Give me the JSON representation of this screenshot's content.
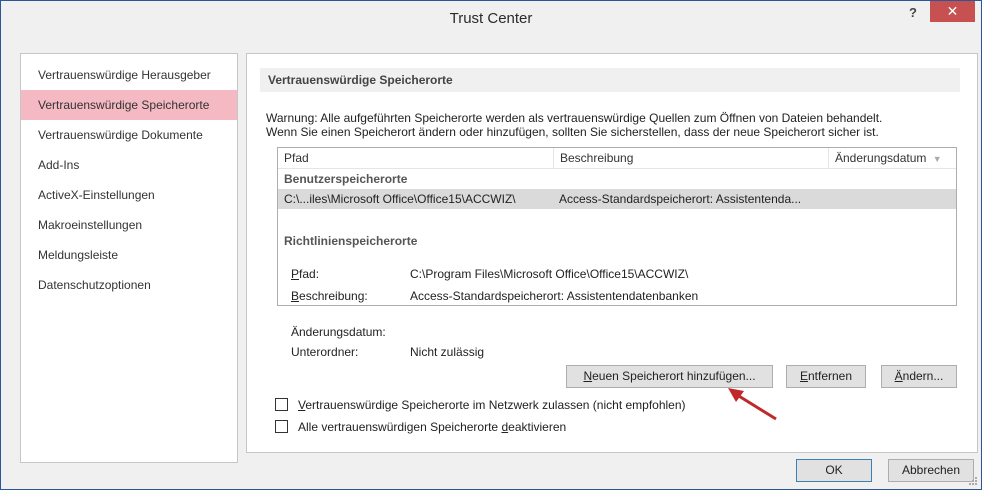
{
  "window": {
    "title": "Trust Center",
    "help_label": "?",
    "close_label": "✕"
  },
  "sidebar": {
    "items": [
      {
        "label": "Vertrauenswürdige Herausgeber"
      },
      {
        "label": "Vertrauenswürdige Speicherorte"
      },
      {
        "label": "Vertrauenswürdige Dokumente"
      },
      {
        "label": "Add-Ins"
      },
      {
        "label": "ActiveX-Einstellungen"
      },
      {
        "label": "Makroeinstellungen"
      },
      {
        "label": "Meldungsleiste"
      },
      {
        "label": "Datenschutzoptionen"
      }
    ]
  },
  "main": {
    "heading": "Vertrauenswürdige Speicherorte",
    "warning_line1": "Warnung: Alle aufgeführten Speicherorte werden als vertrauenswürdige Quellen zum Öffnen von Dateien behandelt.",
    "warning_line2": "Wenn Sie einen Speicherort ändern oder hinzufügen, sollten Sie sicherstellen, dass der neue Speicherort sicher ist.",
    "table": {
      "columns": [
        "Pfad",
        "Beschreibung",
        "Änderungsdatum"
      ],
      "sort_icon": "▼",
      "group_user": "Benutzerspeicherorte",
      "rows": [
        {
          "path": "C:\\...iles\\Microsoft Office\\Office15\\ACCWIZ\\",
          "description": "Access-Standardspeicherort: Assistentenda...",
          "date": ""
        }
      ],
      "group_policy": "Richtlinienspeicherorte"
    },
    "details": {
      "path_label_first": "P",
      "path_label_rest": "fad:",
      "path_value": "C:\\Program Files\\Microsoft Office\\Office15\\ACCWIZ\\",
      "desc_label_first": "B",
      "desc_label_rest": "eschreibung:",
      "desc_value": "Access-Standardspeicherort: Assistentendatenbanken",
      "date_label": "Änderungsdatum:",
      "date_value": "",
      "sub_label": "Unterordner:",
      "sub_value": "Nicht zulässig"
    },
    "buttons": {
      "add_first": "N",
      "add_rest": "euen Speicherort hinzufügen...",
      "remove_first": "E",
      "remove_rest": "ntfernen",
      "modify_first": "Ä",
      "modify_rest": "ndern..."
    },
    "checkboxes": {
      "network_first": "V",
      "network_rest": "ertrauenswürdige Speicherorte im Netzwerk zulassen (nicht empfohlen)",
      "network_checked": false,
      "disable_pre": "Alle vertrauenswürdigen Speicherorte ",
      "disable_u": "d",
      "disable_post": "eaktivieren",
      "disable_checked": false
    }
  },
  "footer": {
    "ok_label": "OK",
    "cancel_label": "Abbrechen"
  },
  "colors": {
    "selected_item": "#f4b9c2",
    "close_button": "#c75050",
    "annotation_arrow": "#c0282a"
  }
}
